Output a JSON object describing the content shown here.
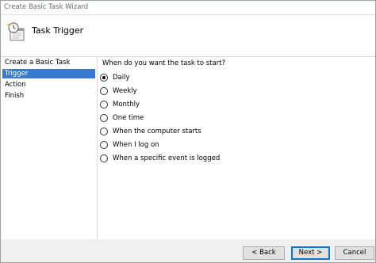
{
  "window": {
    "title": "Create Basic Task Wizard"
  },
  "header": {
    "icon": "task-scheduler-clock-icon",
    "title": "Task Trigger"
  },
  "sidebar": {
    "items": [
      {
        "label": "Create a Basic Task",
        "selected": false
      },
      {
        "label": "Trigger",
        "selected": true
      },
      {
        "label": "Action",
        "selected": false
      },
      {
        "label": "Finish",
        "selected": false
      }
    ],
    "selected_color": "#3a79d3"
  },
  "content": {
    "question": "When do you want the task to start?",
    "options": [
      {
        "label": "Daily",
        "checked": true
      },
      {
        "label": "Weekly",
        "checked": false
      },
      {
        "label": "Monthly",
        "checked": false
      },
      {
        "label": "One time",
        "checked": false
      },
      {
        "label": "When the computer starts",
        "checked": false
      },
      {
        "label": "When I log on",
        "checked": false
      },
      {
        "label": "When a specific event is logged",
        "checked": false
      }
    ]
  },
  "footer": {
    "back_label": "< Back",
    "next_label": "Next >",
    "cancel_label": "Cancel",
    "default_button_color": "#0078d7"
  }
}
